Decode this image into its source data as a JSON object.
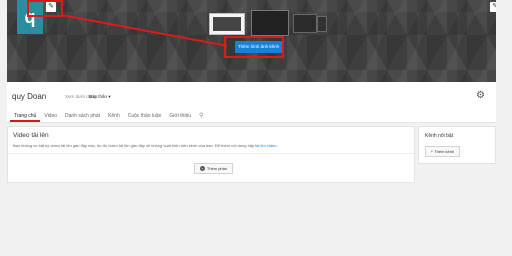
{
  "avatar": {
    "letter": "q"
  },
  "icons": {
    "edit": "pencil-icon",
    "settings": "gear-icon",
    "search": "search-icon",
    "add": "plus-icon"
  },
  "banner": {
    "add_art_label": "Thêm hình ảnh kênh"
  },
  "header": {
    "channel_name": "quy Doan",
    "view_as_label": "Xem dưới dạng:",
    "view_as_value": "Bản thân"
  },
  "tabs": [
    {
      "label": "Trang chủ"
    },
    {
      "label": "Video"
    },
    {
      "label": "Danh sách phát"
    },
    {
      "label": "Kênh"
    },
    {
      "label": "Cuộc thảo luận"
    },
    {
      "label": "Giới thiệu"
    }
  ],
  "uploads": {
    "title": "Video tải lên",
    "description": "Bạn không có bất kỳ video tải lên gần đây nào, do đó video tải lên gần đây sẽ không xuất hiện trên kênh của bạn. Để thêm nội dung hãy",
    "link": "tải lên video."
  },
  "add_section_label": "Thêm phần",
  "featured": {
    "title": "Kênh nổi bật",
    "button_label": "+ Thêm kênh"
  },
  "colors": {
    "annotation": "#d81c1c",
    "accent": "#1e7ed6",
    "tab_active": "#cc181e"
  }
}
